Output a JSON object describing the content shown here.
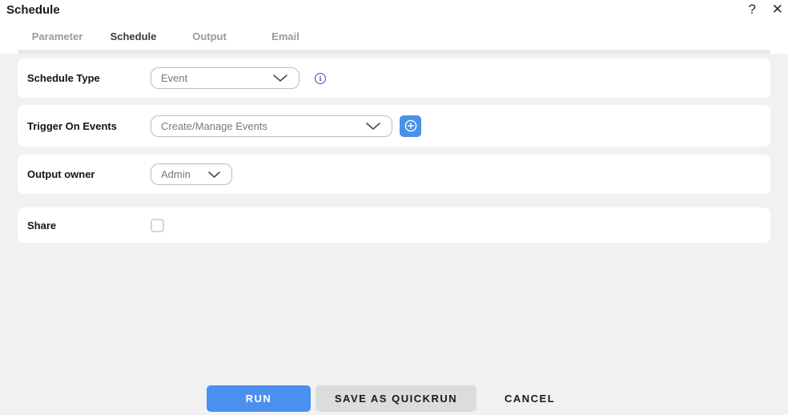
{
  "dialog": {
    "title": "Schedule",
    "help_glyph": "?",
    "close_glyph": "✕"
  },
  "tabs": [
    {
      "label": "Parameter",
      "active": false
    },
    {
      "label": "Schedule",
      "active": true
    },
    {
      "label": "Output",
      "active": false
    },
    {
      "label": "Email",
      "active": false
    }
  ],
  "form": {
    "rows": [
      {
        "label": "Schedule Type",
        "control": "dropdown",
        "value": "Event",
        "has_info_icon": true
      },
      {
        "label": "Trigger On Events",
        "control": "dropdown",
        "value": "Create/Manage Events",
        "has_add_button": true
      },
      {
        "label": "Output owner",
        "control": "dropdown",
        "value": "Admin"
      },
      {
        "label": "Share",
        "control": "checkbox",
        "checked": false
      }
    ]
  },
  "footer": {
    "run_label": "RUN",
    "save_as_quickrun_label": "SAVE AS QUICKRUN",
    "cancel_label": "CANCEL"
  },
  "icons": {
    "help": "question-mark-icon",
    "close": "close-icon",
    "dropdown": "chevron-down-icon",
    "info": "info-icon",
    "add": "plus-circle-icon"
  },
  "colors": {
    "primary_blue": "#4b90ee",
    "add_button_blue": "#4a90e8",
    "info_icon_indigo": "#3b4cc0",
    "active_tab_underline": "#3f3f3f",
    "inactive_tab_text": "#9b9b9b",
    "page_background": "#f1f1f2",
    "save_button_gray": "#dcdcdc",
    "select_border": "#bcbcbc",
    "select_text": "#75787d"
  }
}
